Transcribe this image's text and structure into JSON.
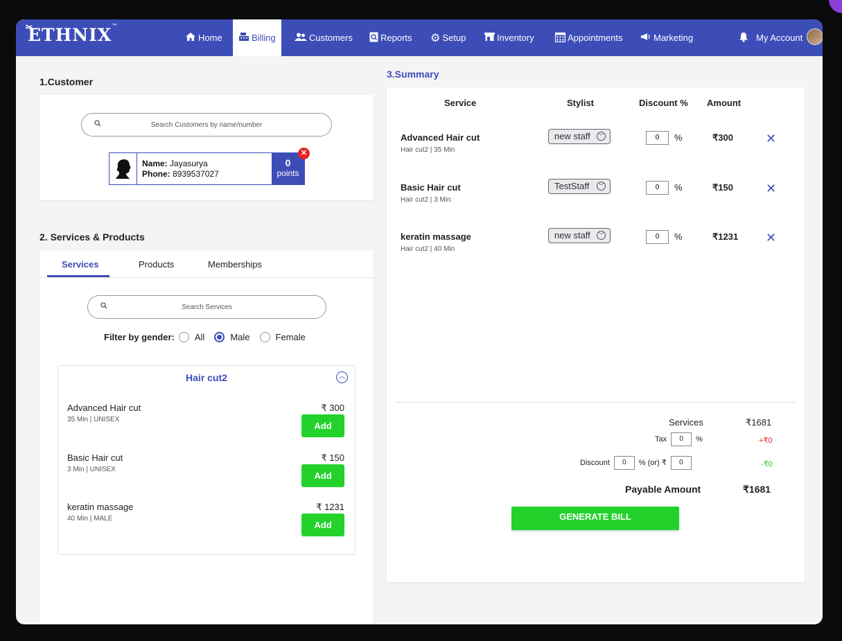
{
  "brand": {
    "logo": "ETHNIX",
    "trademark": "™"
  },
  "nav": {
    "home": "Home",
    "billing": "Billing",
    "customers": "Customers",
    "reports": "Reports",
    "setup": "Setup",
    "inventory": "Inventory",
    "appointments": "Appointments",
    "marketing": "Marketing",
    "account": "My Account"
  },
  "customer": {
    "section_title": "1.Customer",
    "search_placeholder": "Search Customers by name/number",
    "name_label": "Name:",
    "name": "Jayasurya",
    "phone_label": "Phone:",
    "phone": "8939537027",
    "points": "0",
    "points_label": "points"
  },
  "services": {
    "section_title": "2. Services & Products",
    "tabs": [
      "Services",
      "Products",
      "Memberships"
    ],
    "search_placeholder": "Search Services",
    "filter_label": "Filter by gender:",
    "genders": [
      "All",
      "Male",
      "Female"
    ],
    "selected_gender": "Male",
    "category": "Hair cut2",
    "add_label": "Add",
    "items": [
      {
        "name": "Advanced Hair cut",
        "meta": "35 Min | UNISEX",
        "price": "₹ 300"
      },
      {
        "name": "Basic Hair cut",
        "meta": "3 Min | UNISEX",
        "price": "₹ 150"
      },
      {
        "name": "keratin massage",
        "meta": "40 Min | MALE",
        "price": "₹ 1231"
      }
    ]
  },
  "summary": {
    "section_title": "3.Summary",
    "headers": {
      "service": "Service",
      "stylist": "Stylist",
      "discount": "Discount %",
      "amount": "Amount"
    },
    "rows": [
      {
        "name": "Advanced Hair cut",
        "meta": "Hair cut2 | 35 Min",
        "stylist": "new staff",
        "discount": "0",
        "pct": "%",
        "amount": "₹300"
      },
      {
        "name": "Basic Hair cut",
        "meta": "Hair cut2 | 3 Min",
        "stylist": "TestStaff",
        "discount": "0",
        "pct": "%",
        "amount": "₹150"
      },
      {
        "name": "keratin massage",
        "meta": "Hair cut2 | 40 Min",
        "stylist": "new staff",
        "discount": "0",
        "pct": "%",
        "amount": "₹1231"
      }
    ],
    "totals": {
      "services_label": "Services",
      "services_value": "₹1681",
      "tax_label": "Tax",
      "tax_input": "0",
      "tax_pct": "%",
      "tax_value": "+₹0",
      "discount_label": "Discount",
      "discount_pct_input": "0",
      "discount_or": "% (or) ₹",
      "discount_amt_input": "0",
      "discount_value": "-₹0",
      "payable_label": "Payable Amount",
      "payable_value": "₹1681"
    },
    "generate_label": "GENERATE BILL"
  },
  "colors": {
    "brand": "#3d4db8",
    "add": "#22d22b",
    "remove": "#e52323",
    "tax": "#e52323",
    "discount": "#22c02b"
  }
}
